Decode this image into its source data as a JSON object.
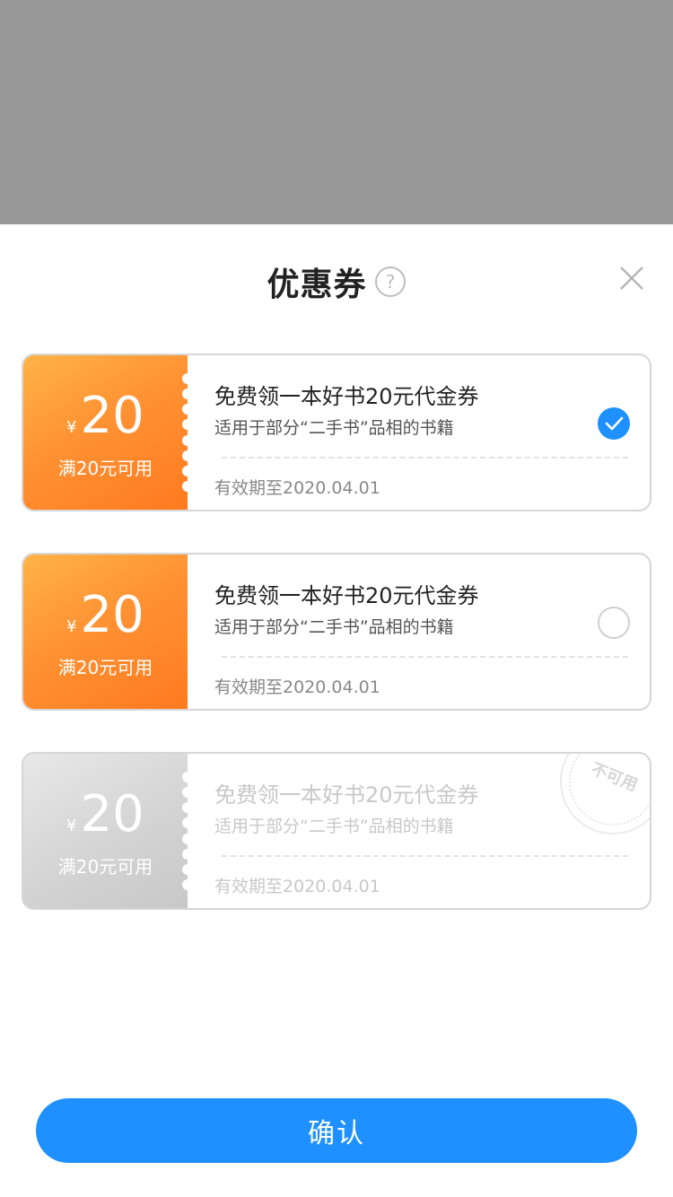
{
  "header": {
    "title": "优惠券"
  },
  "coupons": [
    {
      "currency": "¥",
      "amount": "20",
      "condition": "满20元可用",
      "title": "免费领一本好书20元代金券",
      "desc": "适用于部分“二手书”品相的书籍",
      "expiry": "有效期至2020.04.01",
      "state": "selected"
    },
    {
      "currency": "¥",
      "amount": "20",
      "condition": "满20元可用",
      "title": "免费领一本好书20元代金券",
      "desc": "适用于部分“二手书”品相的书籍",
      "expiry": "有效期至2020.04.01",
      "state": "unselected"
    },
    {
      "currency": "¥",
      "amount": "20",
      "condition": "满20元可用",
      "title": "免费领一本好书20元代金券",
      "desc": "适用于部分“二手书”品相的书籍",
      "expiry": "有效期至2020.04.01",
      "state": "unavailable",
      "stamp_text": "不可用"
    }
  ],
  "confirm_label": "确认",
  "colors": {
    "accent": "#1e90ff",
    "coupon_orange": "#ff8c2a",
    "overlay": "#999999"
  }
}
